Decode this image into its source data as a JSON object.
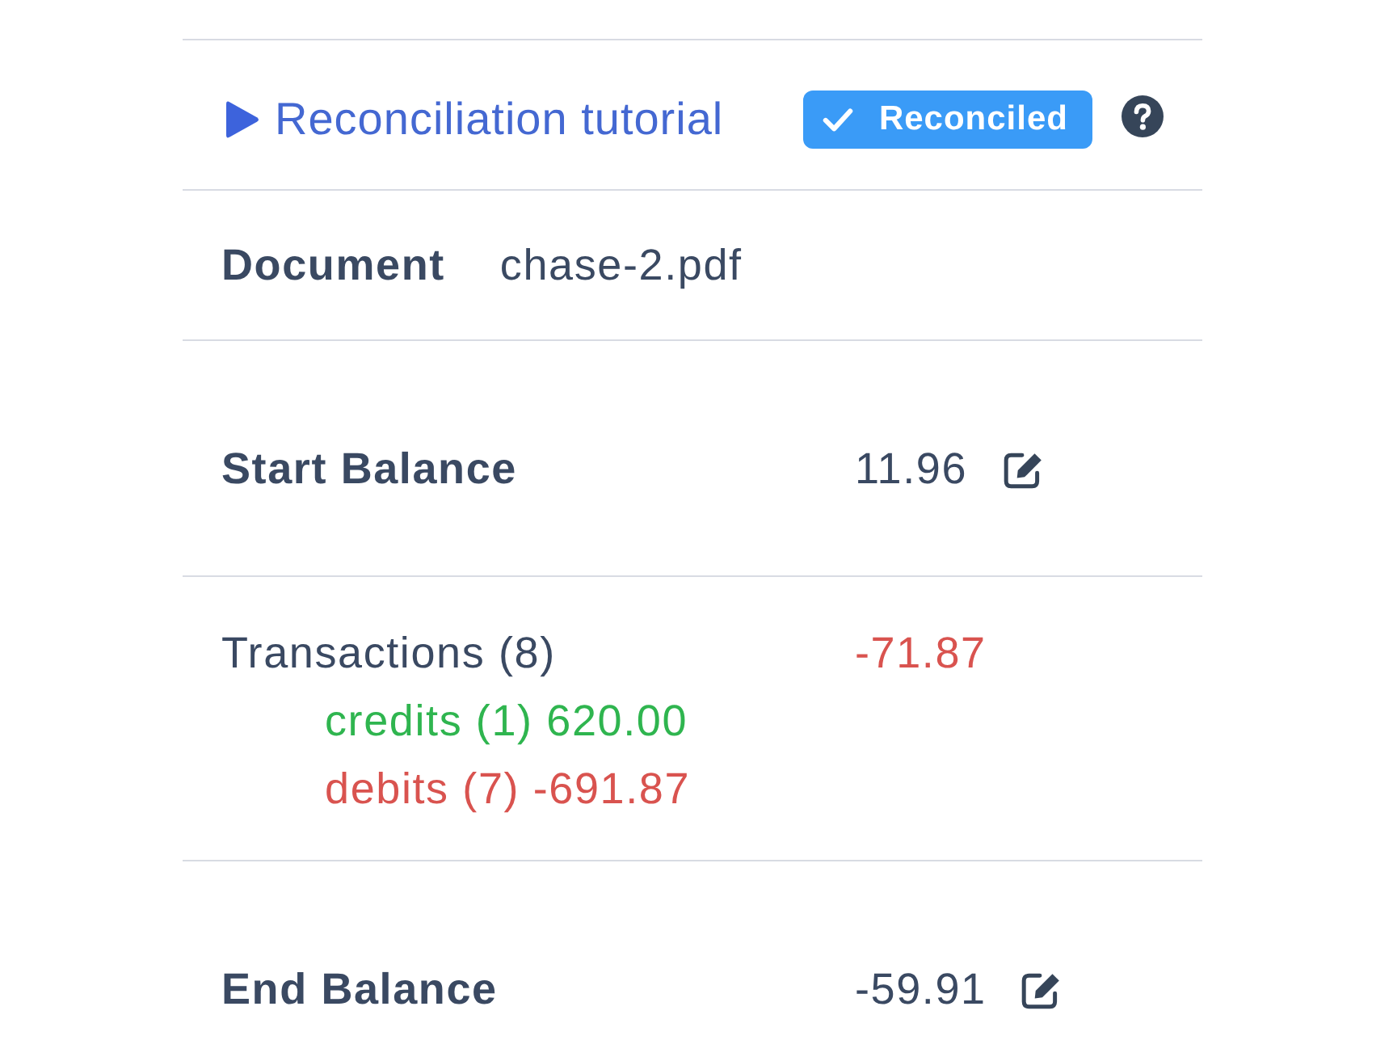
{
  "tutorial_link": {
    "label": "Reconciliation tutorial"
  },
  "status_badge": {
    "label": "Reconciled"
  },
  "document": {
    "label": "Document",
    "value": "chase-2.pdf"
  },
  "rows": [
    {
      "kind": "balance",
      "label": "Start Balance",
      "value": "11.96"
    },
    {
      "kind": "transactions",
      "label": "Transactions (8)",
      "value": "-71.87",
      "breakdown": [
        {
          "text": "credits (1) 620.00",
          "color": "#2fb54f"
        },
        {
          "text": "debits (7) -691.87",
          "color": "#d9534f"
        }
      ]
    },
    {
      "kind": "balance",
      "label": "End Balance",
      "value": "-59.91"
    }
  ]
}
